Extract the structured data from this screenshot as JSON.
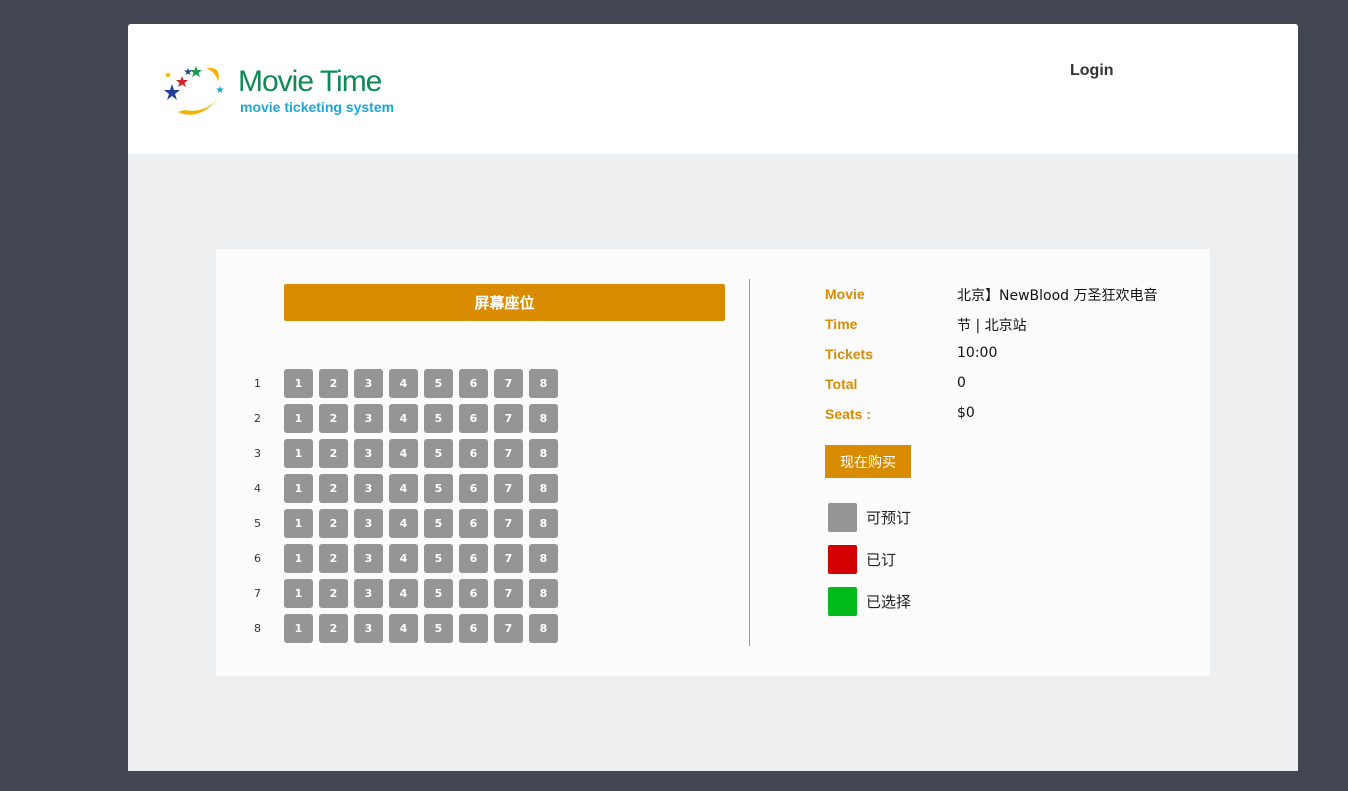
{
  "header": {
    "logo_title": "Movie Time",
    "logo_subtitle": "movie ticketing system",
    "login_label": "Login"
  },
  "seating": {
    "screen_label": "屏幕座位",
    "rows": [
      "1",
      "2",
      "3",
      "4",
      "5",
      "6",
      "7",
      "8"
    ],
    "seat_numbers": [
      "1",
      "2",
      "3",
      "4",
      "5",
      "6",
      "7",
      "8"
    ],
    "seat_color_available": "#959595"
  },
  "info": {
    "labels": {
      "movie": "Movie",
      "time": "Time",
      "tickets": "Tickets",
      "total": "Total",
      "seats": "Seats :"
    },
    "values": {
      "line1": "北京】NewBlood 万圣狂欢电音",
      "line2": "节 | 北京站",
      "line3": "10:00",
      "line4": "0",
      "line5": "$0"
    }
  },
  "buy_button_label": "现在购买",
  "legend": {
    "available": {
      "label": "可预订",
      "color": "#959595"
    },
    "booked": {
      "label": "已订",
      "color": "#d20000"
    },
    "selected": {
      "label": "已选择",
      "color": "#00bb1a"
    }
  },
  "colors": {
    "accent": "#d98c02",
    "background": "#414651",
    "content_bg": "#edeef0"
  }
}
